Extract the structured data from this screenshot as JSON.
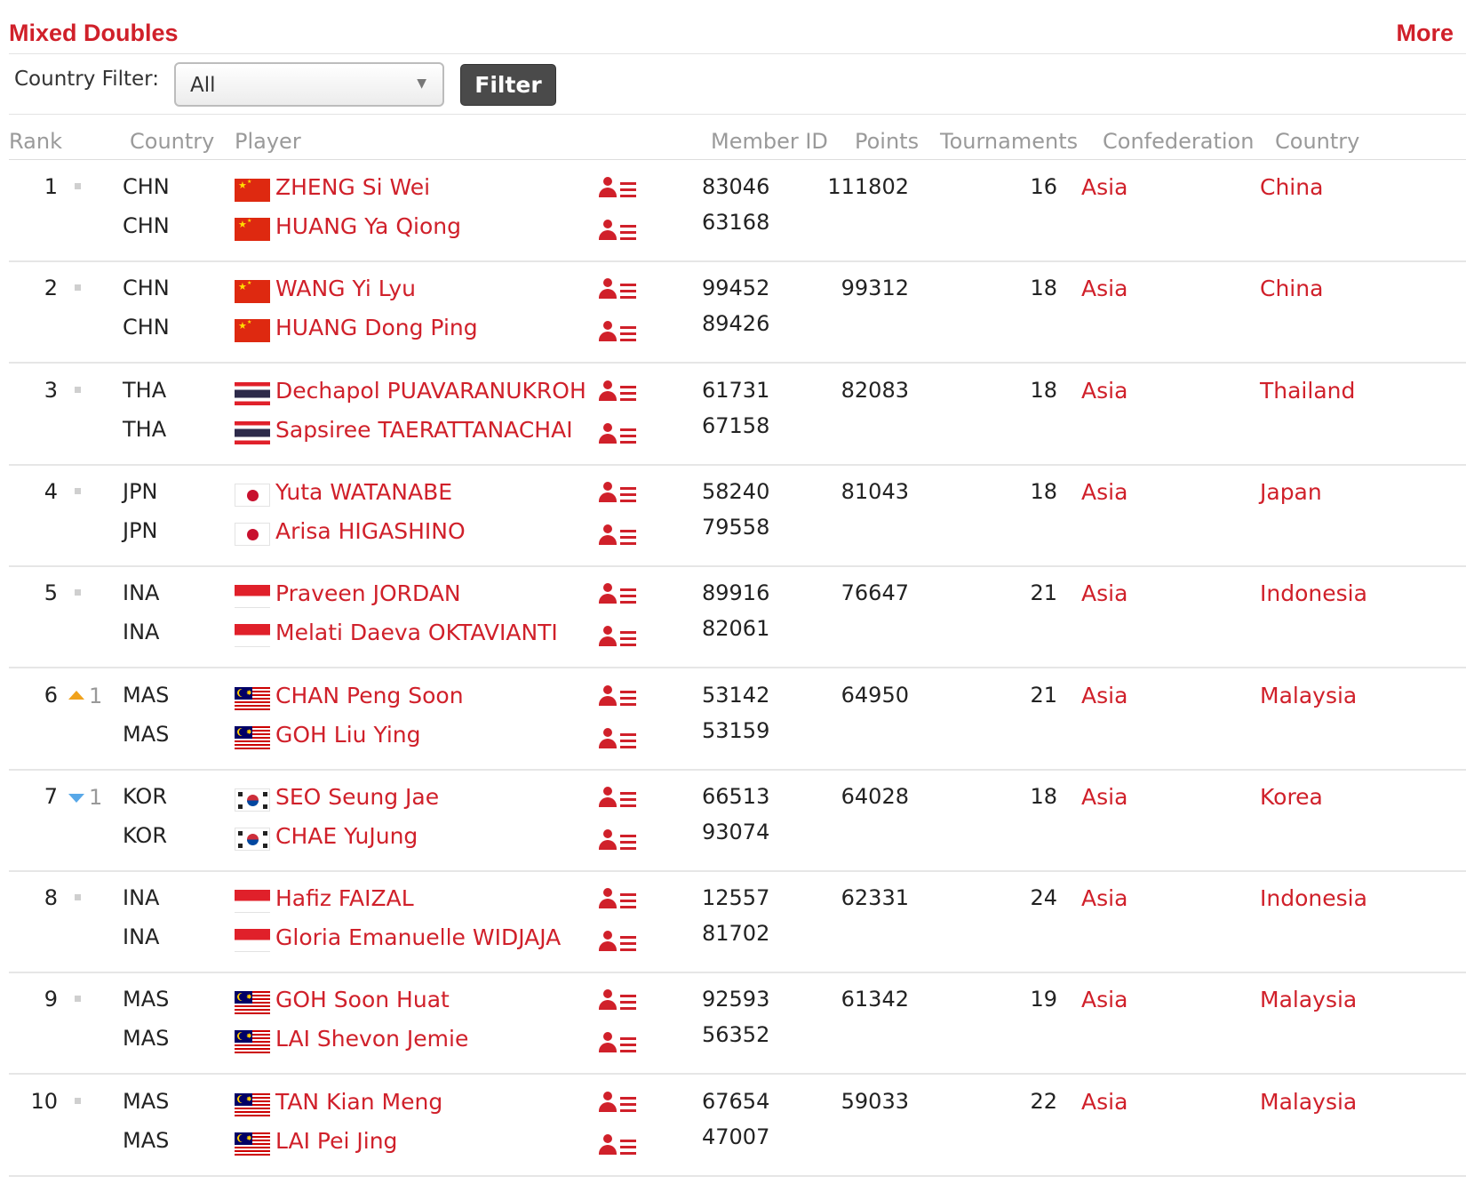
{
  "section": {
    "title": "Mixed Doubles",
    "more": "More"
  },
  "filter": {
    "label": "Country Filter:",
    "selected": "All",
    "button": "Filter"
  },
  "headers": {
    "rank": "Rank",
    "country": "Country",
    "player": "Player",
    "member_id": "Member ID",
    "points": "Points",
    "tournaments": "Tournaments",
    "confederation": "Confederation",
    "country2": "Country"
  },
  "rows": [
    {
      "rank": "1",
      "movement": "same",
      "change": "",
      "players": [
        {
          "cc": "CHN",
          "flag": "china-flag",
          "name": "ZHENG Si Wei",
          "member_id": "83046"
        },
        {
          "cc": "CHN",
          "flag": "china-flag",
          "name": "HUANG Ya Qiong",
          "member_id": "63168"
        }
      ],
      "points": "111802",
      "tournaments": "16",
      "confederation": "Asia",
      "country": "China"
    },
    {
      "rank": "2",
      "movement": "same",
      "change": "",
      "players": [
        {
          "cc": "CHN",
          "flag": "china-flag",
          "name": "WANG Yi Lyu",
          "member_id": "99452"
        },
        {
          "cc": "CHN",
          "flag": "china-flag",
          "name": "HUANG Dong Ping",
          "member_id": "89426"
        }
      ],
      "points": "99312",
      "tournaments": "18",
      "confederation": "Asia",
      "country": "China"
    },
    {
      "rank": "3",
      "movement": "same",
      "change": "",
      "players": [
        {
          "cc": "THA",
          "flag": "thailand-flag",
          "name": "Dechapol PUAVARANUKROH",
          "member_id": "61731"
        },
        {
          "cc": "THA",
          "flag": "thailand-flag",
          "name": "Sapsiree TAERATTANACHAI",
          "member_id": "67158"
        }
      ],
      "points": "82083",
      "tournaments": "18",
      "confederation": "Asia",
      "country": "Thailand"
    },
    {
      "rank": "4",
      "movement": "same",
      "change": "",
      "players": [
        {
          "cc": "JPN",
          "flag": "japan-flag",
          "name": "Yuta WATANABE",
          "member_id": "58240"
        },
        {
          "cc": "JPN",
          "flag": "japan-flag",
          "name": "Arisa HIGASHINO",
          "member_id": "79558"
        }
      ],
      "points": "81043",
      "tournaments": "18",
      "confederation": "Asia",
      "country": "Japan"
    },
    {
      "rank": "5",
      "movement": "same",
      "change": "",
      "players": [
        {
          "cc": "INA",
          "flag": "indonesia-flag",
          "name": "Praveen JORDAN",
          "member_id": "89916"
        },
        {
          "cc": "INA",
          "flag": "indonesia-flag",
          "name": "Melati Daeva OKTAVIANTI",
          "member_id": "82061"
        }
      ],
      "points": "76647",
      "tournaments": "21",
      "confederation": "Asia",
      "country": "Indonesia"
    },
    {
      "rank": "6",
      "movement": "up",
      "change": "1",
      "players": [
        {
          "cc": "MAS",
          "flag": "malaysia-flag",
          "name": "CHAN Peng Soon",
          "member_id": "53142"
        },
        {
          "cc": "MAS",
          "flag": "malaysia-flag",
          "name": "GOH Liu Ying",
          "member_id": "53159"
        }
      ],
      "points": "64950",
      "tournaments": "21",
      "confederation": "Asia",
      "country": "Malaysia"
    },
    {
      "rank": "7",
      "movement": "down",
      "change": "1",
      "players": [
        {
          "cc": "KOR",
          "flag": "korea-flag",
          "name": "SEO Seung Jae",
          "member_id": "66513"
        },
        {
          "cc": "KOR",
          "flag": "korea-flag",
          "name": "CHAE YuJung",
          "member_id": "93074"
        }
      ],
      "points": "64028",
      "tournaments": "18",
      "confederation": "Asia",
      "country": "Korea"
    },
    {
      "rank": "8",
      "movement": "same",
      "change": "",
      "players": [
        {
          "cc": "INA",
          "flag": "indonesia-flag",
          "name": "Hafiz FAIZAL",
          "member_id": "12557"
        },
        {
          "cc": "INA",
          "flag": "indonesia-flag",
          "name": "Gloria Emanuelle WIDJAJA",
          "member_id": "81702"
        }
      ],
      "points": "62331",
      "tournaments": "24",
      "confederation": "Asia",
      "country": "Indonesia"
    },
    {
      "rank": "9",
      "movement": "same",
      "change": "",
      "players": [
        {
          "cc": "MAS",
          "flag": "malaysia-flag",
          "name": "GOH Soon Huat",
          "member_id": "92593"
        },
        {
          "cc": "MAS",
          "flag": "malaysia-flag",
          "name": "LAI Shevon Jemie",
          "member_id": "56352"
        }
      ],
      "points": "61342",
      "tournaments": "19",
      "confederation": "Asia",
      "country": "Malaysia"
    },
    {
      "rank": "10",
      "movement": "same",
      "change": "",
      "players": [
        {
          "cc": "MAS",
          "flag": "malaysia-flag",
          "name": "TAN Kian Meng",
          "member_id": "67654"
        },
        {
          "cc": "MAS",
          "flag": "malaysia-flag",
          "name": "LAI Pei Jing",
          "member_id": "47007"
        }
      ],
      "points": "59033",
      "tournaments": "22",
      "confederation": "Asia",
      "country": "Malaysia"
    }
  ]
}
